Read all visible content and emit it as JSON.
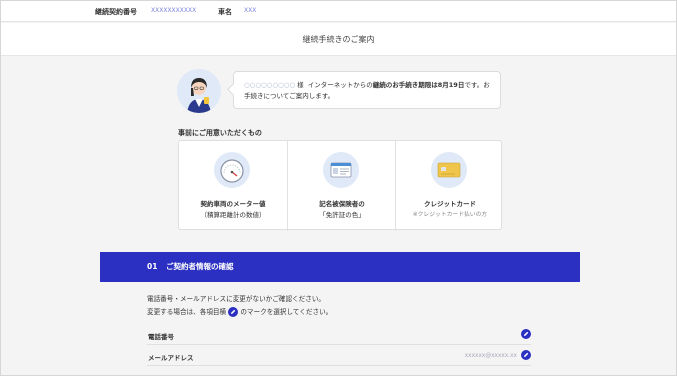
{
  "header": {
    "contract_label": "継続契約番号",
    "contract_value": "XXXXXXXXXXX",
    "car_label": "車名",
    "car_value": "XXX"
  },
  "page_title": "継続手続きのご案内",
  "greeting": {
    "name": "○○○○○○○○○",
    "honorific": "様",
    "text_before": "インターネットからの",
    "text_bold": "継続のお手続き期限は8月19日",
    "text_after": "です。お",
    "line2": "手続きについてご案内します。"
  },
  "preparation": {
    "title": "事前にご用意いただくもの",
    "items": [
      {
        "icon": "speedometer-icon",
        "line1": "契約車両のメーター値",
        "line2": "（積算距離計の数値）"
      },
      {
        "icon": "license-card-icon",
        "line1": "記名被保険者の",
        "line2": "「免許証の色」"
      },
      {
        "icon": "credit-card-icon",
        "line1": "クレジットカード",
        "line2": "※クレジットカード払いの方"
      }
    ]
  },
  "section": {
    "number": "01",
    "title": "ご契約者情報の確認",
    "note1": "電話番号・メールアドレスに変更がないかご確認ください。",
    "note2_before": "変更する場合は、各項目横",
    "note2_after": "のマークを選択してください。",
    "rows": [
      {
        "label": "電話番号",
        "value": ""
      },
      {
        "label": "メールアドレス",
        "value": "xxxxxx@xxxxx.xx"
      }
    ]
  },
  "colors": {
    "accent": "#2b2fc2",
    "icon_bg": "#dfe9f7"
  }
}
